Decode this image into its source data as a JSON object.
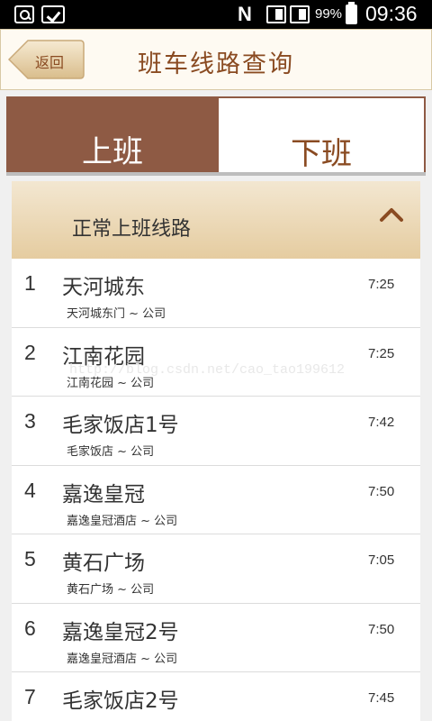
{
  "status_bar": {
    "nfc": "N",
    "battery_percent": "99%",
    "time": "09:36",
    "icons": [
      "search-icon",
      "check-icon",
      "nfc-icon",
      "sim1-icon",
      "sim2-icon",
      "battery-icon"
    ]
  },
  "header": {
    "back_label": "返回",
    "title": "班车线路查询"
  },
  "tabs": [
    {
      "label": "上班",
      "active": true
    },
    {
      "label": "下班",
      "active": false
    }
  ],
  "section": {
    "title": "正常上班线路",
    "expanded": true
  },
  "routes": [
    {
      "num": "1",
      "name": "天河城东",
      "sub": "天河城东门 ~ 公司",
      "time": "7:25"
    },
    {
      "num": "2",
      "name": "江南花园",
      "sub": "江南花园 ~ 公司",
      "time": "7:25"
    },
    {
      "num": "3",
      "name": "毛家饭店1号",
      "sub": "毛家饭店 ~ 公司",
      "time": "7:42"
    },
    {
      "num": "4",
      "name": "嘉逸皇冠",
      "sub": "嘉逸皇冠酒店 ~ 公司",
      "time": "7:50"
    },
    {
      "num": "5",
      "name": "黄石广场",
      "sub": "黄石广场 ~ 公司",
      "time": "7:05"
    },
    {
      "num": "6",
      "name": "嘉逸皇冠2号",
      "sub": "嘉逸皇冠酒店 ~ 公司",
      "time": "7:50"
    },
    {
      "num": "7",
      "name": "毛家饭店2号",
      "sub": "",
      "time": "7:45"
    }
  ],
  "watermark": "http://blog.csdn.net/cao_tao199612",
  "colors": {
    "accent": "#8e5a44",
    "title_text": "#8a4b22",
    "header_bg": "#fefaf2",
    "section_gradient_top": "#f3e7d1",
    "section_gradient_bottom": "#e5cca0"
  }
}
